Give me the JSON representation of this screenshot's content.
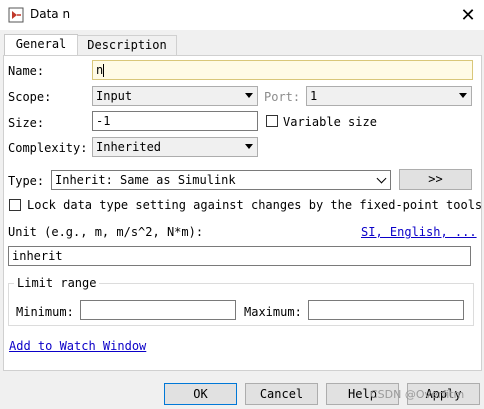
{
  "window": {
    "title": "Data n",
    "close_glyph": "✕"
  },
  "tabs": [
    {
      "label": "General"
    },
    {
      "label": "Description"
    }
  ],
  "form": {
    "name_label": "Name:",
    "name_value": "n",
    "scope_label": "Scope:",
    "scope_value": "Input",
    "port_label": "Port:",
    "port_value": "1",
    "size_label": "Size:",
    "size_value": "-1",
    "variable_size_label": "Variable size",
    "complexity_label": "Complexity:",
    "complexity_value": "Inherited",
    "type_label": "Type:",
    "type_value": "Inherit: Same as Simulink",
    "type_assistant_button": ">>",
    "lock_label": "Lock data type setting against changes by the fixed-point tools",
    "unit_label": "Unit (e.g., m, m/s^2, N*m):",
    "unit_link": "SI, English, ...",
    "unit_value": "inherit",
    "limit_range_label": "Limit range",
    "minimum_label": "Minimum:",
    "minimum_value": "",
    "maximum_label": "Maximum:",
    "maximum_value": "",
    "watch_link": "Add to Watch Window"
  },
  "buttons": {
    "ok": "OK",
    "cancel": "Cancel",
    "help": "Help",
    "apply": "Apply"
  },
  "watermark": "CSDN @Overfitm",
  "colors": {
    "link": "#0b00c8",
    "name_field_bg": "#fffbe6",
    "default_button_border": "#0078d7"
  }
}
